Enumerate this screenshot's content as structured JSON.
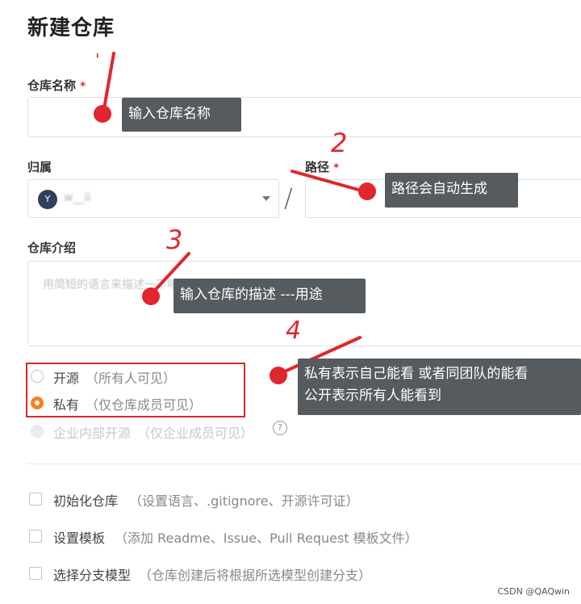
{
  "page": {
    "title": "新建仓库"
  },
  "fields": {
    "name_label": "仓库名称",
    "required_mark": "*",
    "owner_label": "归属",
    "owner_avatar_letter": "Y",
    "owner_value": "w__ii",
    "path_label": "路径",
    "path_separator": "/",
    "desc_label": "仓库介绍",
    "desc_placeholder": "用简短的语言来描述一下吧"
  },
  "visibility": {
    "open_label": "开源",
    "open_sub": "（所有人可见）",
    "private_label": "私有",
    "private_sub": "（仅仓库成员可见）",
    "internal_label": "企业内部开源",
    "internal_sub": "（仅企业成员可见）",
    "selected": "private"
  },
  "options": {
    "init_label": "初始化仓库",
    "init_sub": "（设置语言、.gitignore、开源许可证）",
    "template_label": "设置模板",
    "template_sub": "（添加 Readme、Issue、Pull Request 模板文件）",
    "branch_label": "选择分支模型",
    "branch_sub": "（仓库创建后将根据所选模型创建分支）"
  },
  "annotations": {
    "tip1": "输入仓库名称",
    "tip2": "路径会自动生成",
    "tip3": "输入仓库的描述 ---用途",
    "tip4_line1": "私有表示自己能看 或者同团队的能看",
    "tip4_line2": "公开表示所有人能看到",
    "num1": "'",
    "num2": "2",
    "num3": "3",
    "num4": "4"
  },
  "watermark": "CSDN @QAQwin",
  "colors": {
    "required": "#e0262e",
    "radio_selected": "#f5821f",
    "tooltip_bg": "#555b5e",
    "annotation_red": "#e0262e"
  }
}
